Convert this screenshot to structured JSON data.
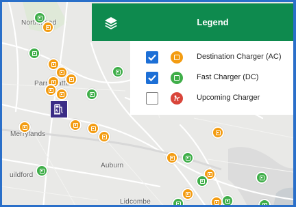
{
  "map": {
    "places": {
      "northmead": "Northmead",
      "parramatta": "Parramatta",
      "merrylands": "Merrylands",
      "auburn": "Auburn",
      "guildford": "uildford",
      "lidcombe": "Lidcombe"
    },
    "colors": {
      "land": "#e9e9e7",
      "park": "#d4e8cc",
      "water": "#a9d3e6",
      "road": "#ffffff",
      "ac_marker": "#f39c12",
      "dc_marker": "#3fae49",
      "station": "#3b2d86",
      "frame": "#2a6fc9"
    },
    "marker_icon": "charger-dollar-icon",
    "station_icon": "ev-charging-station-icon"
  },
  "legend": {
    "title": "Legend",
    "layers_icon": "layers-icon",
    "header_color": "#0e8a4e",
    "items": [
      {
        "label": "Destination Charger (AC)",
        "checked": true,
        "icon": "ac-charger-icon",
        "color": "#f39c12"
      },
      {
        "label": "Fast Charger (DC)",
        "checked": true,
        "icon": "dc-charger-icon",
        "color": "#3fae49"
      },
      {
        "label": "Upcoming Charger",
        "checked": false,
        "icon": "upcoming-construction-icon",
        "color": "#d9453a"
      }
    ]
  }
}
